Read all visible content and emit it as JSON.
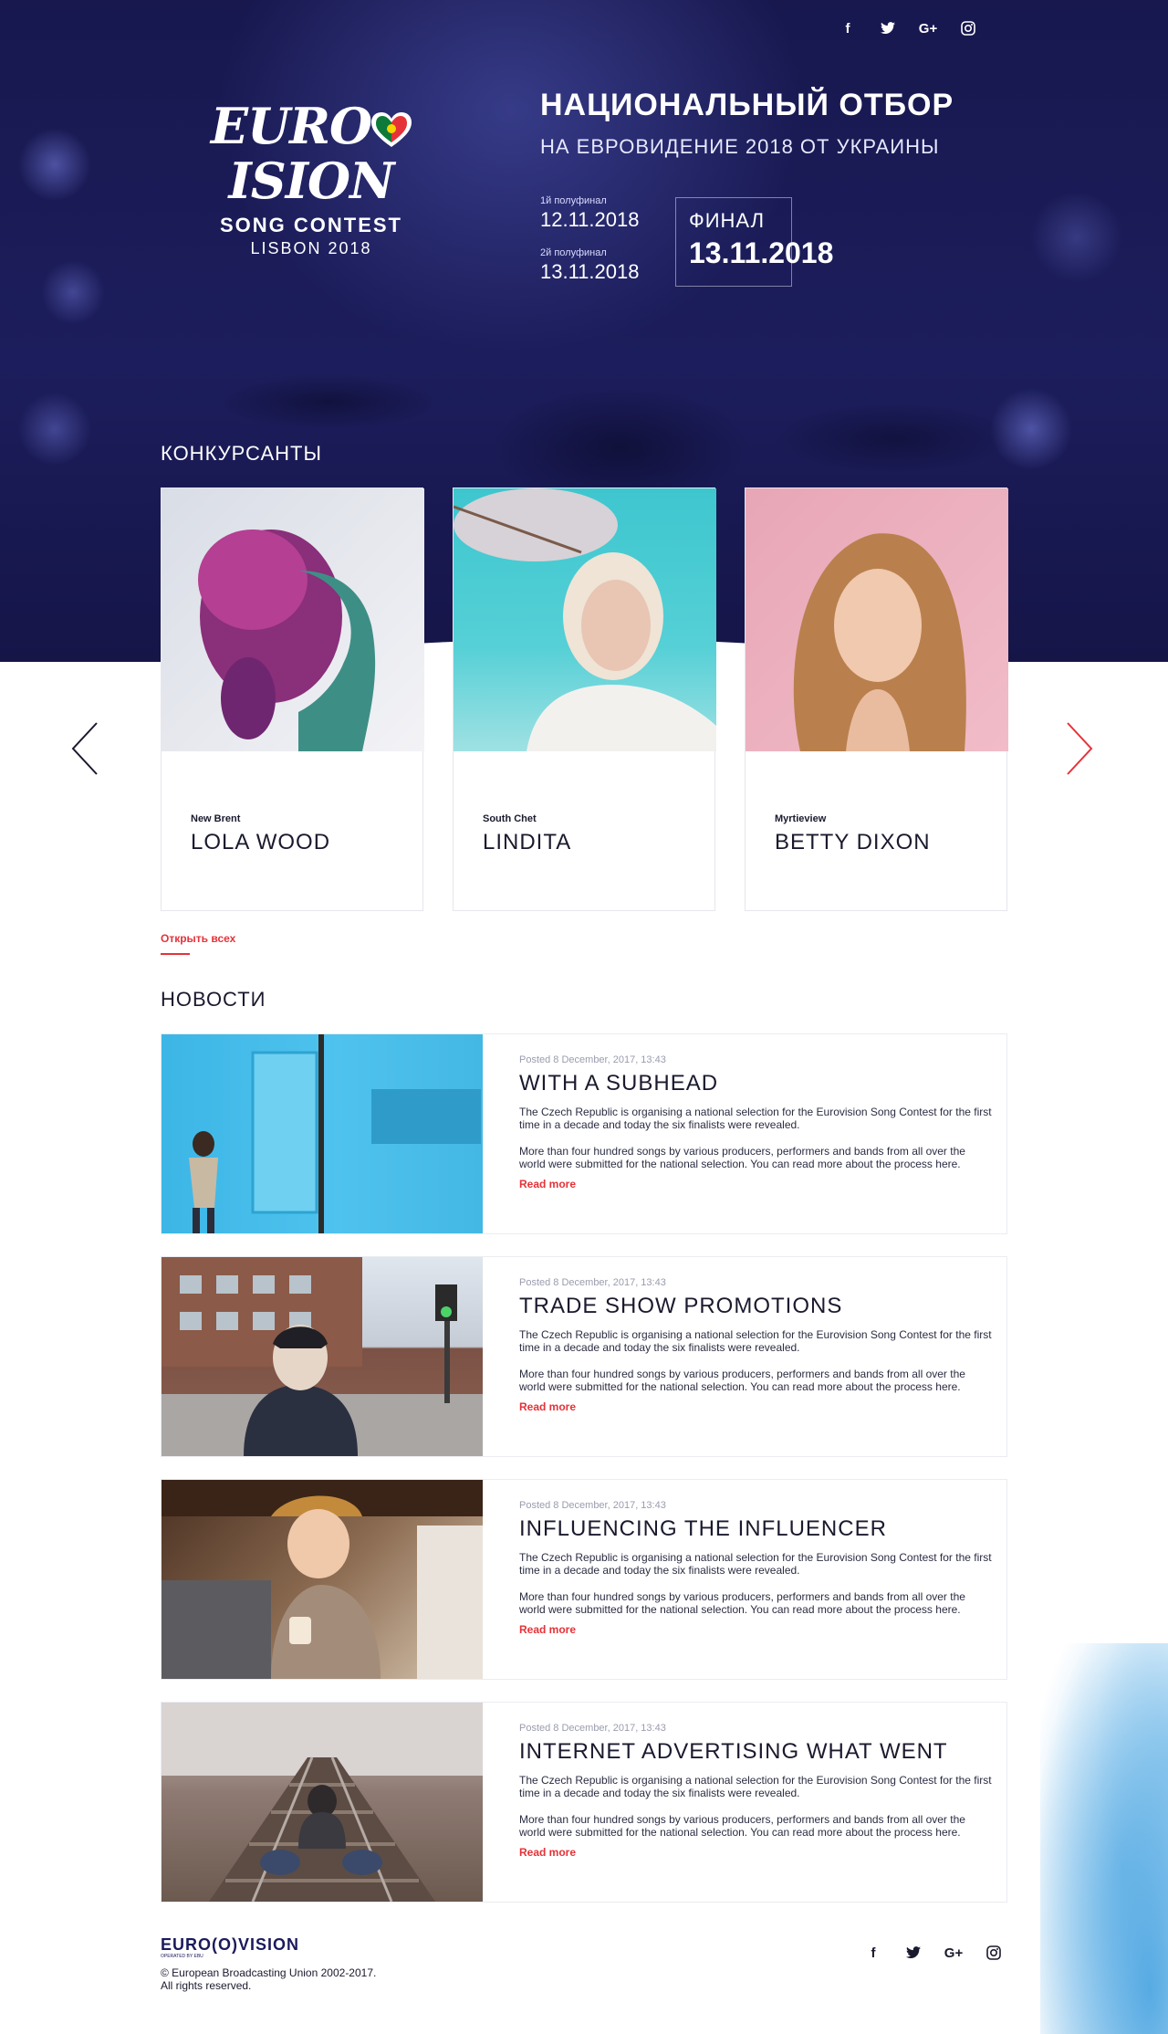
{
  "hero": {
    "logo": {
      "brand_prefix": "EURO",
      "brand_suffix": "ISION",
      "song_contest": "SONG CONTEST",
      "city": "LISBON 2018"
    },
    "title": "НАЦИОНАЛЬНЫЙ ОТБОР",
    "subtitle": "НА ЕВРОВИДЕНИЕ 2018 ОТ УКРАИНЫ",
    "semifinal_1": {
      "label": "1й полуфинал",
      "date": "12.11.2018"
    },
    "semifinal_2": {
      "label": "2й полуфинал",
      "date": "13.11.2018"
    },
    "final": {
      "label": "ФИНАЛ",
      "date": "13.11.2018"
    }
  },
  "social": {
    "icons": [
      "facebook-icon",
      "twitter-icon",
      "google-plus-icon",
      "instagram-icon"
    ],
    "facebook": "f",
    "google_plus": "G+"
  },
  "contestants": {
    "title": "КОНКУРСАНТЫ",
    "items": [
      {
        "city": "New Brent",
        "name": "LOLA WOOD"
      },
      {
        "city": "South Chet",
        "name": "LINDITA"
      },
      {
        "city": "Myrtieview",
        "name": "BETTY DIXON"
      }
    ],
    "open_all": "Открыть всех"
  },
  "news": {
    "title": "НОВОСТИ",
    "items": [
      {
        "meta": "Posted 8 December, 2017, 13:43",
        "title": "WITH A SUBHEAD",
        "p1": "The Czech Republic is organising a national selection for the Eurovision Song Contest for the first time in a decade and today the six finalists were revealed.",
        "p2": "More than four hundred songs by various producers, performers and bands from all over the world were submitted for the national selection. You can read more about the process here.",
        "more": "Read more"
      },
      {
        "meta": "Posted 8 December, 2017, 13:43",
        "title": "TRADE SHOW PROMOTIONS",
        "p1": "The Czech Republic is organising a national selection for the Eurovision Song Contest for the first time in a decade and today the six finalists were revealed.",
        "p2": "More than four hundred songs by various producers, performers and bands from all over the world were submitted for the national selection. You can read more about the process here.",
        "more": "Read more"
      },
      {
        "meta": "Posted 8 December, 2017, 13:43",
        "title": "INFLUENCING THE INFLUENCER",
        "p1": "The Czech Republic is organising a national selection for the Eurovision Song Contest for the first time in a decade and today the six finalists were revealed.",
        "p2": "More than four hundred songs by various producers, performers and bands from all over the world were submitted for the national selection. You can read more about the process here.",
        "more": "Read more"
      },
      {
        "meta": "Posted 8 December, 2017, 13:43",
        "title": "INTERNET ADVERTISING WHAT WENT",
        "p1": "The Czech Republic is organising a national selection for the Eurovision Song Contest for the first time in a decade and today the six finalists were revealed.",
        "p2": "More than four hundred songs by various producers, performers and bands from all over the world were submitted for the national selection. You can read more about the process here.",
        "more": "Read more"
      }
    ]
  },
  "footer": {
    "logo": "EURO(O)VISION",
    "logo_sub": "OPERATED BY EBU",
    "copyright_1": "© European Broadcasting Union 2002-2017.",
    "copyright_2": "All rights reserved."
  },
  "colors": {
    "hero_bg": "#1c1d5c",
    "accent": "#e53238",
    "text_dark": "#1a1a2e"
  }
}
